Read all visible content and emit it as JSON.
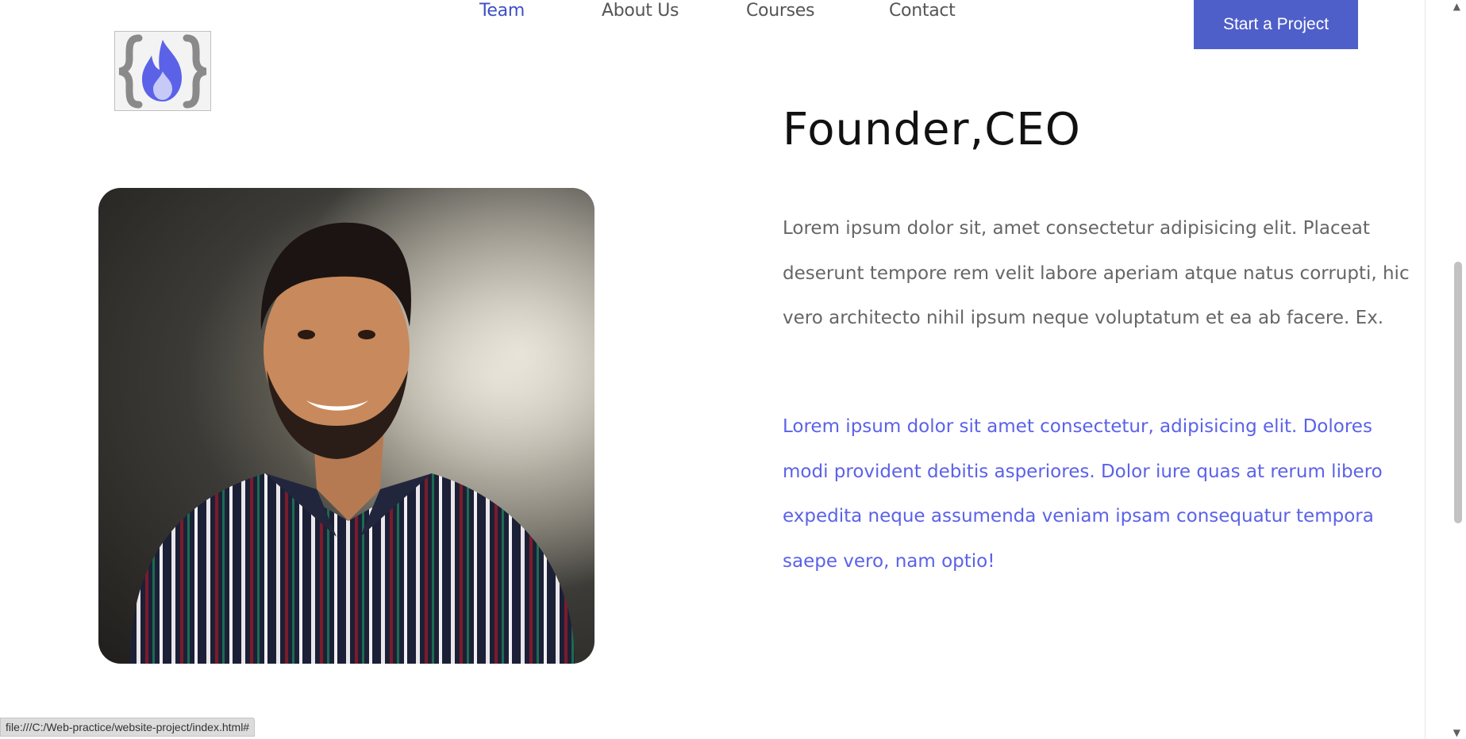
{
  "nav": {
    "items": [
      "Team",
      "About Us",
      "Courses",
      "Contact"
    ],
    "cta_label": "Start a Project"
  },
  "logo": {
    "name": "code-flame-logo",
    "accent": "#5b62e8"
  },
  "profile": {
    "title": "Founder,CEO",
    "paragraph_1": "Lorem ipsum dolor sit, amet consectetur adipisicing elit. Placeat deserunt tempore rem velit labore aperiam atque natus corrupti, hic vero architecto nihil ipsum neque voluptatum et ea ab facere. Ex.",
    "paragraph_2": "Lorem ipsum dolor sit amet consectetur, adipisicing elit. Dolores modi provident debitis asperiores. Dolor iure quas at rerum libero expedita neque assumenda veniam ipsam consequatur tempora saepe vero, nam optio!"
  },
  "statusbar": {
    "url": "file:///C:/Web-practice/website-project/index.html#"
  },
  "colors": {
    "nav_active": "#3f4fc6",
    "cta_bg": "#4f5fc9",
    "blue_text": "#5b62e8",
    "gray_text": "#666666"
  }
}
